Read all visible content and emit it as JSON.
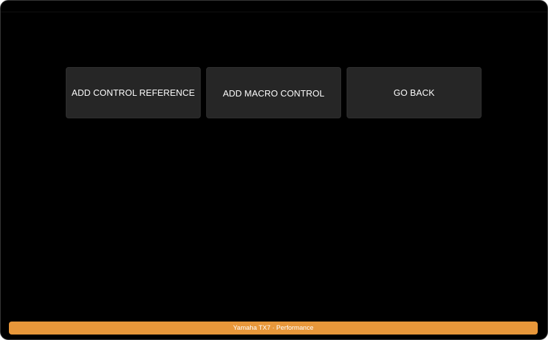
{
  "actions": {
    "add_control_reference": "ADD CONTROL REFERENCE",
    "add_macro_control": "ADD MACRO CONTROL",
    "go_back": "GO BACK"
  },
  "status_bar": {
    "text": "Yamaha TX7 · Performance"
  },
  "colors": {
    "background": "#000000",
    "button": "#262626",
    "status_bar": "#e8973a"
  }
}
